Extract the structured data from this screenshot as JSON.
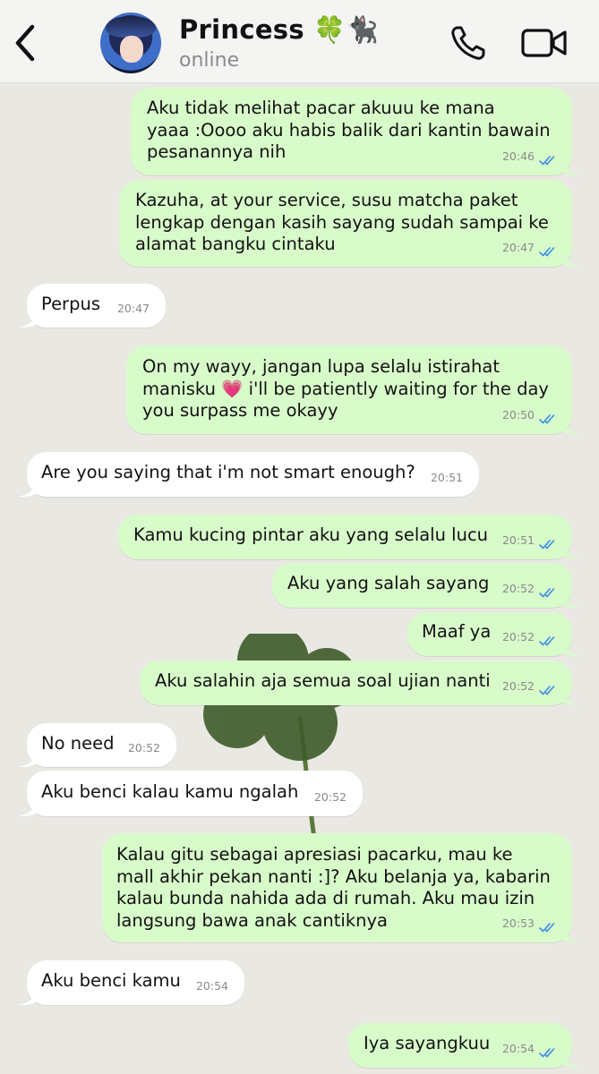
{
  "header": {
    "contact_name": "Princess 🍀🐈‍⬛",
    "status": "online",
    "icons": [
      "back-chevron-icon",
      "avatar",
      "phone-icon",
      "video-call-icon"
    ]
  },
  "colors": {
    "outgoing_bubble": "#d8fbca",
    "incoming_bubble": "#ffffff",
    "ticks": "#3d8fe6",
    "background": "#e9e8e3"
  },
  "messages": [
    {
      "dir": "out",
      "text": "Aku tidak melihat pacar akuuu ke mana\nyaaa :Oooo aku habis balik dari kantin bawain\npesanannya nih",
      "time": "20:46",
      "read": true
    },
    {
      "dir": "out",
      "text": "Kazuha, at your service, susu matcha paket\nlengkap dengan kasih sayang sudah sampai ke\nalamat bangku cintaku",
      "time": "20:47",
      "read": true
    },
    {
      "dir": "in",
      "text": "Perpus",
      "time": "20:47"
    },
    {
      "dir": "out",
      "text": "On my wayy, jangan lupa selalu istirahat\nmanisku 💗 i'll be patiently waiting for the day\nyou surpass me okayy",
      "time": "20:50",
      "read": true
    },
    {
      "dir": "in",
      "text": "Are you saying that i'm not smart enough?",
      "time": "20:51"
    },
    {
      "dir": "out",
      "text": "Kamu kucing pintar aku yang selalu lucu",
      "time": "20:51",
      "read": true
    },
    {
      "dir": "out",
      "text": "Aku yang salah sayang",
      "time": "20:52",
      "read": true
    },
    {
      "dir": "out",
      "text": "Maaf ya",
      "time": "20:52",
      "read": true
    },
    {
      "dir": "out",
      "text": "Aku salahin aja semua soal ujian nanti",
      "time": "20:52",
      "read": true
    },
    {
      "dir": "in",
      "text": "No need",
      "time": "20:52"
    },
    {
      "dir": "in",
      "text": "Aku benci kalau kamu ngalah",
      "time": "20:52"
    },
    {
      "dir": "out",
      "text": "Kalau gitu sebagai apresiasi pacarku, mau ke\nmall akhir pekan nanti :]? Aku belanja ya, kabarin\nkalau bunda nahida ada di rumah. Aku mau izin\nlangsung bawa anak cantiknya",
      "time": "20:53",
      "read": true
    },
    {
      "dir": "in",
      "text": "Aku benci kamu",
      "time": "20:54"
    },
    {
      "dir": "out",
      "text": "Iya sayangkuu",
      "time": "20:54",
      "read": true
    }
  ]
}
